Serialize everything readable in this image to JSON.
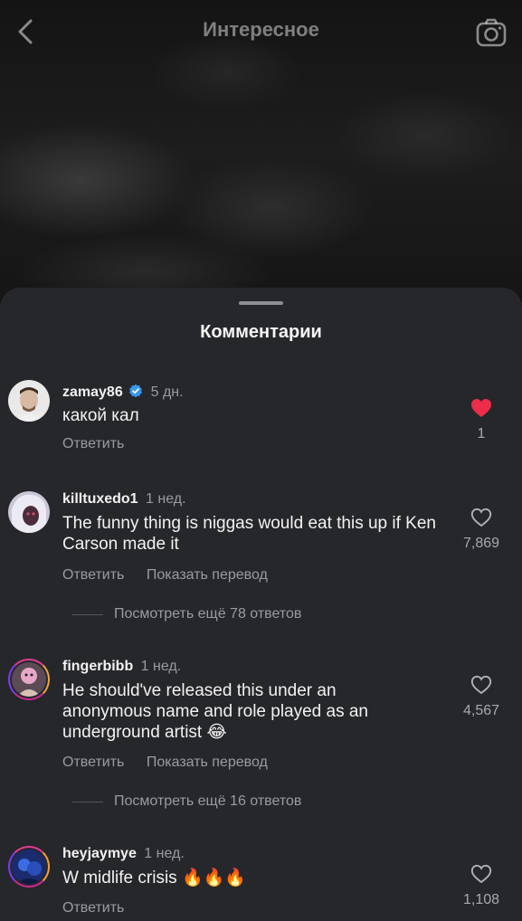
{
  "header": {
    "title": "Интересное"
  },
  "sheet": {
    "title": "Комментарии"
  },
  "labels": {
    "reply": "Ответить",
    "translate": "Показать перевод"
  },
  "comments": [
    {
      "user": "zamay86",
      "verified": true,
      "time": "5 дн.",
      "text": "какой кал",
      "likes": "1",
      "liked": true
    },
    {
      "user": "killtuxedo1",
      "time": "1 нед.",
      "text": "The funny thing is niggas would eat this up if Ken Carson made it",
      "likes": "7,869",
      "more_replies": "Посмотреть ещё 78 ответов"
    },
    {
      "user": "fingerbibb",
      "time": "1 нед.",
      "text": "He should've released this under an anonymous name and role played as an underground artist 😂",
      "likes": "4,567",
      "more_replies": "Посмотреть ещё 16 ответов"
    },
    {
      "user": "heyjaymye",
      "time": "1 нед.",
      "text": "W midlife crisis 🔥🔥🔥",
      "likes": "1,108"
    }
  ],
  "colors": {
    "sheet_bg": "#26272b",
    "heart_red": "#ed2d4a",
    "verified_blue": "#3897f0"
  }
}
